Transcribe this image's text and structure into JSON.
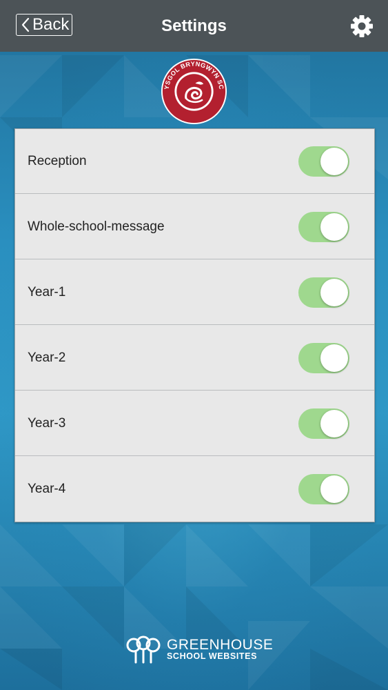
{
  "header": {
    "back_label": "Back",
    "title": "Settings",
    "settings_icon": "gear-icon"
  },
  "logo": {
    "text": "YSGOL BRYNGWYN SCHOOL",
    "icon": "dragon-emblem"
  },
  "settings": {
    "rows": [
      {
        "label": "Reception",
        "enabled": true
      },
      {
        "label": "Whole-school-message",
        "enabled": true
      },
      {
        "label": "Year-1",
        "enabled": true
      },
      {
        "label": "Year-2",
        "enabled": true
      },
      {
        "label": "Year-3",
        "enabled": true
      },
      {
        "label": "Year-4",
        "enabled": true
      }
    ]
  },
  "footer": {
    "brand": "GREENHOUSE",
    "tagline": "SCHOOL WEBSITES",
    "icon": "greenhouse-logo"
  },
  "colors": {
    "topbar": "#4c5357",
    "toggle_on": "#9fd88e",
    "background": "#2a86b0",
    "logo_red": "#b3202f"
  }
}
